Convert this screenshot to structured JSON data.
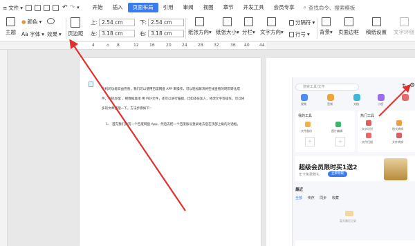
{
  "menubar": {
    "file": "文件",
    "tabs": [
      "开始",
      "插入",
      "页面布局",
      "引用",
      "审阅",
      "视图",
      "章节",
      "开发工具",
      "会员专享"
    ],
    "active_tab": "页面布局",
    "search_placeholder": "查找命令、搜索模板"
  },
  "ribbon": {
    "theme": "主题",
    "colors": "颜色",
    "font": "Aa 字体",
    "effects": "效果",
    "margins": "页边距",
    "top_label": "上:",
    "top_value": "2.54 cm",
    "bottom_label": "下:",
    "bottom_value": "2.54 cm",
    "left_label": "左:",
    "left_value": "3.18 cm",
    "right_label": "右:",
    "right_value": "3.18 cm",
    "orientation": "纸张方向",
    "size": "纸张大小",
    "columns": "分栏",
    "text_direction": "文字方向",
    "breaks": "分隔符",
    "line_numbers": "行号",
    "background": "背景",
    "page_border": "页面边框",
    "paper_setup": "稿纸设置",
    "text_wrap": "文字环绕"
  },
  "ruler": {
    "ticks": [
      "4",
      "8",
      "12",
      "16",
      "20",
      "24",
      "28",
      "32",
      "36",
      "40",
      "44"
    ]
  },
  "document": {
    "lines": [
      "手机的功能日益完善，我们可以使用百度网盘 APP 来操作，可以轻松解决将在线查看的网页转化成",
      "件，手机办理 ，把数据直接 用 PDF文件，还可以进行编辑，比如还在加入，修改文字等操作。可以将",
      "多的文章整理一下，方法步骤如下：",
      "1、 首先我们要有一个百度网盘 App，然后去把一个百度账号登录进去后在顶部上角的对话框。"
    ]
  },
  "phone": {
    "search": "搜索工具/文件",
    "apps": [
      "视频",
      "音频",
      "文档",
      "小程",
      "合集"
    ],
    "my_tools": "我的工具",
    "hot_tools": "热门工具",
    "tool_items": [
      "文件备份",
      "图片编辑",
      "文字识别",
      "格式转换",
      "文件扫描",
      "文件转换"
    ],
    "banner_title": "超级会员限时买1送2",
    "banner_sub": "年卡免费赠礼",
    "banner_btn": "立即领取",
    "recent": "最近",
    "sub_tabs": [
      "全部",
      "传存",
      "同步",
      "收藏"
    ],
    "empty": "暂无最近记录"
  },
  "colors": {
    "accent": "#3a7cf0",
    "arrow": "#e0312d"
  }
}
